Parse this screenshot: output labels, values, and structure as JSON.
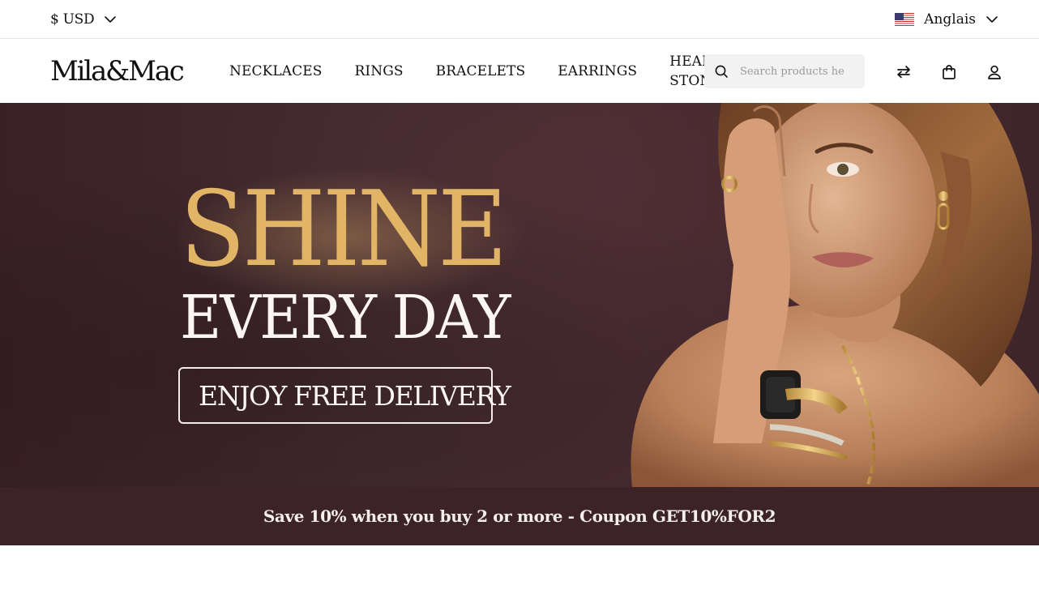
{
  "topbar": {
    "currency_label": "$ USD",
    "language_label": "Anglais",
    "language_flag": "us-flag-icon"
  },
  "header": {
    "logo": "Mila&Mac",
    "nav": [
      {
        "label": "NECKLACES"
      },
      {
        "label": "RINGS"
      },
      {
        "label": "BRACELETS"
      },
      {
        "label": "EARRINGS"
      },
      {
        "label": "HEALING STONES"
      }
    ],
    "search": {
      "placeholder": "Search products he",
      "value": ""
    },
    "icons": [
      "compare-icon",
      "shopping-bag-icon",
      "account-icon"
    ]
  },
  "hero": {
    "headline": "SHINE",
    "subheadline": "EVERY DAY",
    "cta_label": "ENJOY FREE DELIVERY",
    "colors": {
      "background": "#422a2f",
      "accent": "#e2b466",
      "text": "#fbf6f2"
    }
  },
  "promo": {
    "text": "Save 10% when you buy 2 or more - Coupon GET10%FOR2",
    "background": "#3c2328"
  }
}
